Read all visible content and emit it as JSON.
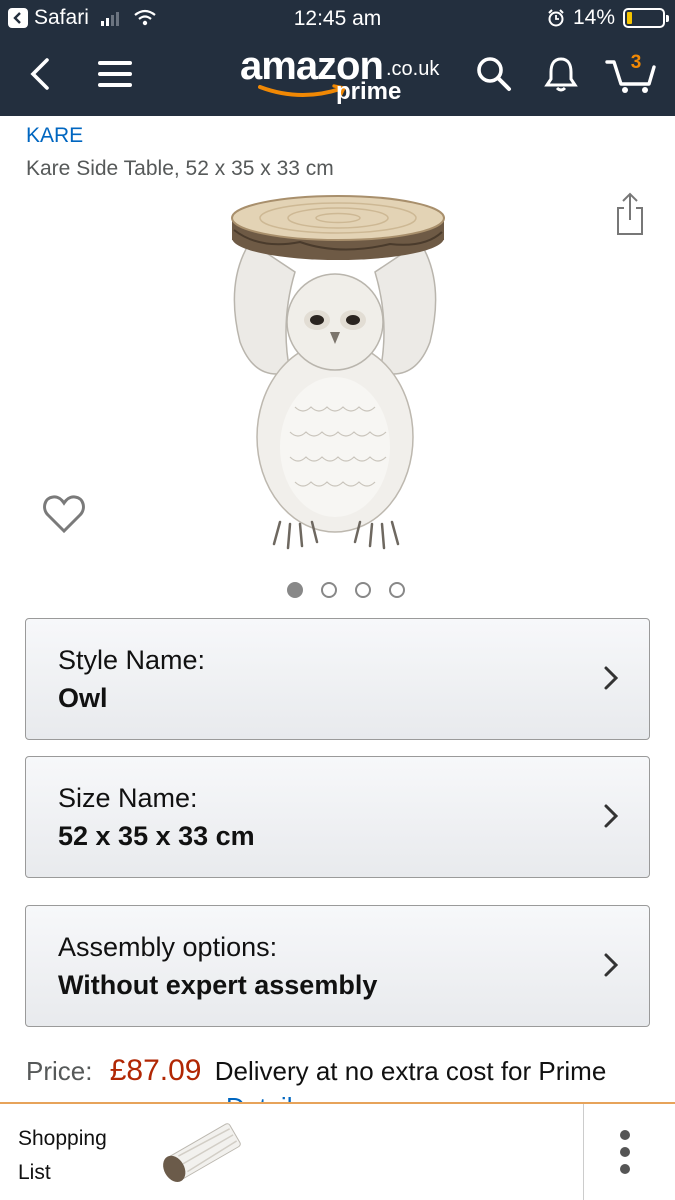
{
  "status_bar": {
    "back_app": "Safari",
    "time": "12:45 am",
    "battery": "14%",
    "battery_level": 0.14
  },
  "nav": {
    "logo_text": "amazon",
    "logo_tld": ".co.uk",
    "logo_sub": "prime",
    "cart_count": "3",
    "icons": [
      "back-icon",
      "menu-icon",
      "search-icon",
      "bell-icon",
      "cart-icon"
    ]
  },
  "product": {
    "brand": "KARE",
    "title": "Kare Side Table, 52 x 35 x 33 cm",
    "image_count": 4,
    "active_image": 1
  },
  "options": [
    {
      "label": "Style Name:",
      "value": "Owl"
    },
    {
      "label": "Size Name:",
      "value": "52 x 35 x 33 cm"
    },
    {
      "label": "Assembly options:",
      "value": "Without expert assembly"
    }
  ],
  "price": {
    "label": "Price:",
    "value": "£87.09",
    "description": "Delivery at no extra cost for Prime",
    "details_link": "Detail"
  },
  "bottom_bar": {
    "label": "Shopping List"
  },
  "colors": {
    "header_bg": "#232f3e",
    "link": "#0066c0",
    "price": "#b12704",
    "accent": "#f08804"
  }
}
